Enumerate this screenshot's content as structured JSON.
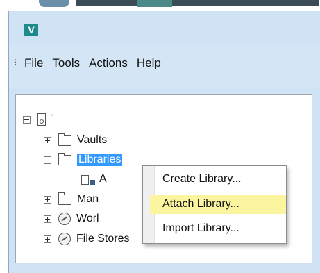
{
  "app": {
    "icon_letter": "V",
    "icon_name": "vault-app-icon",
    "accent": "#1f8a8a"
  },
  "menubar": {
    "grip": "⁝",
    "items": [
      "File",
      "Tools",
      "Actions",
      "Help"
    ]
  },
  "tree": {
    "root_mark": "'",
    "items": [
      {
        "label": "Vaults",
        "expander": "plus",
        "icon": "folder-icon"
      },
      {
        "label": "Libraries",
        "expander": "minus",
        "icon": "folder-icon",
        "selected": true
      },
      {
        "label": "A",
        "icon": "library-icon"
      },
      {
        "label": "Man",
        "expander": "plus",
        "icon": "folder-icon"
      },
      {
        "label": "Worl",
        "expander": "plus",
        "icon": "gauge-icon"
      },
      {
        "label": "File Stores",
        "expander": "plus",
        "icon": "gauge-icon"
      }
    ]
  },
  "context_menu": {
    "items": [
      "Create Library...",
      "Attach Library...",
      "Import Library..."
    ],
    "highlighted_index": 1,
    "highlight_color": "#fbf5a0"
  },
  "colors": {
    "window_bg": "#cfe3f4",
    "selection": "#3399ff"
  }
}
